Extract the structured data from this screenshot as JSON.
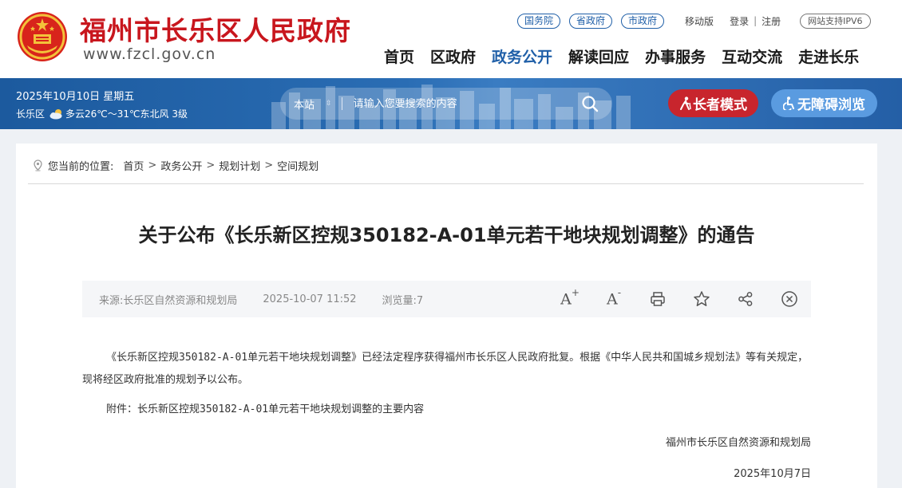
{
  "header": {
    "site_title": "福州市长乐区人民政府",
    "site_domain": "www.fzcl.gov.cn",
    "top_links": [
      "国务院",
      "省政府",
      "市政府"
    ],
    "mobile": "移动版",
    "login": "登录",
    "sep": "|",
    "register": "注册",
    "ipv6": "网站支持IPV6",
    "nav": [
      "首页",
      "区政府",
      "政务公开",
      "解读回应",
      "办事服务",
      "互动交流",
      "走进长乐"
    ],
    "active_nav": "政务公开",
    "colors": {
      "brand_red": "#c8161d",
      "nav_blue": "#1f5fa8"
    }
  },
  "banner": {
    "date": "2025年10月10日 星期五",
    "region": "长乐区",
    "weather": "多云26℃～31℃东北风 3级",
    "search_scope": "本站",
    "search_placeholder": "请输入您要搜索的内容",
    "elder_mode": "长者模式",
    "accessible": "无障碍浏览"
  },
  "breadcrumb": {
    "prefix": "您当前的位置:",
    "items": [
      "首页",
      "政务公开",
      "规划计划",
      "空间规划"
    ],
    "arrow": ">"
  },
  "article": {
    "title": "关于公布《长乐新区控规350182-A-01单元若干地块规划调整》的通告",
    "source": "来源:长乐区自然资源和规划局",
    "date": "2025-10-07 11:52",
    "views": "浏览量:7",
    "tools": {
      "font_up": "A",
      "font_up_sign": "+",
      "font_down": "A",
      "font_down_sign": "-",
      "icons": [
        "font-increase-icon",
        "font-decrease-icon",
        "print-icon",
        "star-icon",
        "share-icon",
        "close-icon"
      ]
    },
    "paragraph": "《长乐新区控规350182-A-01单元若干地块规划调整》已经法定程序获得福州市长乐区人民政府批复。根据《中华人民共和国城乡规划法》等有关规定，现将经区政府批准的规划予以公布。",
    "attachment_label": "附件：",
    "attachment_link": "长乐新区控规350182-A-01单元若干地块规划调整的主要内容",
    "signature_org": "福州市长乐区自然资源和规划局",
    "signature_date": "2025年10月7日"
  }
}
